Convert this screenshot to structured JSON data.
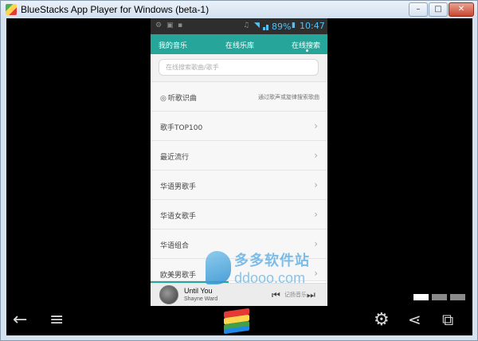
{
  "window": {
    "title": "BlueStacks App Player for Windows (beta-1)",
    "min_label": "–",
    "max_label": "□",
    "close_label": "✕"
  },
  "statusbar": {
    "battery": "89%",
    "time": "10:47",
    "icons": [
      "settings-icon",
      "image-icon",
      "headset-icon",
      "wifi-icon",
      "signal-icon",
      "battery-icon"
    ]
  },
  "tabs": [
    {
      "label": "我的音乐"
    },
    {
      "label": "在线乐库"
    },
    {
      "label": "在线搜索",
      "active": true
    }
  ],
  "search": {
    "placeholder": "在线搜索歌曲/歌手"
  },
  "list": [
    {
      "label": "听歌识曲",
      "sub": "通过歌声或旋律搜索歌曲",
      "icon": "listen-icon"
    },
    {
      "label": "歌手TOP100"
    },
    {
      "label": "最近流行"
    },
    {
      "label": "华语男歌手"
    },
    {
      "label": "华语女歌手"
    },
    {
      "label": "华语组合"
    },
    {
      "label": "欧美男歌手"
    }
  ],
  "player": {
    "song": "Until You",
    "artist": "Shayne Ward",
    "overlay_text": "记扬音乐",
    "progress": 0.44
  },
  "watermark": {
    "cn": "多多软件站",
    "url": "ddooo.com"
  },
  "colors": {
    "accent": "#26a69a",
    "status_blue": "#4fc3f7"
  }
}
